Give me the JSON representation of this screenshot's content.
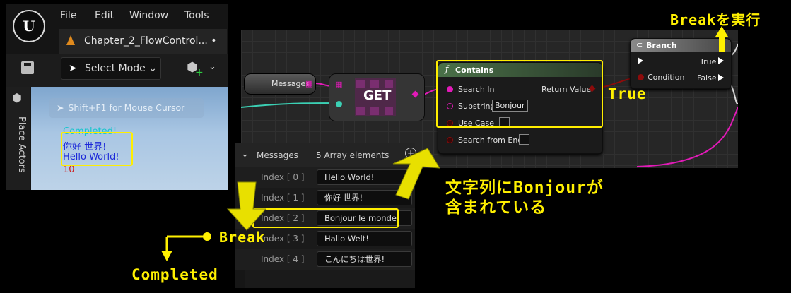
{
  "editor": {
    "logo": "U",
    "menu": [
      "File",
      "Edit",
      "Window",
      "Tools"
    ],
    "tab_title": "Chapter_2_FlowControl...",
    "tab_modified": "•",
    "select_mode": "Select Mode",
    "place_actors": "Place Actors",
    "shift_hint": "Shift+F1 for Mouse Cursor",
    "log_lines": [
      {
        "text": "Completed!",
        "color": "#17c5cd"
      },
      {
        "text": "你好 世界!",
        "color": "#1c28d9"
      },
      {
        "text": "Hello World!",
        "color": "#1c28d9"
      },
      {
        "text": "10",
        "color": "#cc2020"
      }
    ]
  },
  "graph": {
    "messages_label": "Messages",
    "get_label": "GET",
    "contains": {
      "title": "Contains",
      "func_glyph": "ƒ",
      "search_in": "Search In",
      "substring": "Substring",
      "substring_value": "Bonjour",
      "use_case": "Use Case",
      "search_from_end": "Search from End",
      "return_value": "Return Value"
    },
    "branch": {
      "title": "Branch",
      "condition": "Condition",
      "true_label": "True",
      "false_label": "False"
    }
  },
  "details": {
    "header_label": "Messages",
    "header_value": "5 Array elements",
    "rows": [
      {
        "index": "Index [ 0 ]",
        "value": "Hello World!"
      },
      {
        "index": "Index [ 1 ]",
        "value": "你好 世界!"
      },
      {
        "index": "Index [ 2 ]",
        "value": "Bonjour le monde!"
      },
      {
        "index": "Index [ 3 ]",
        "value": "Hallo Welt!"
      },
      {
        "index": "Index [ 4 ]",
        "value": "こんにちは世界!"
      }
    ]
  },
  "annotations": {
    "break_exec": "Breakを実行",
    "true_label": "True",
    "contains_bonjour_line1": "文字列にBonjourが",
    "contains_bonjour_line2": "含まれている",
    "break_label": "Break",
    "completed_label": "Completed"
  },
  "colors": {
    "highlight": "#ffee00",
    "string_pin": "#e21ab8",
    "bool_pin": "#8d0b0b",
    "wire_teal": "#3bd0b4"
  }
}
